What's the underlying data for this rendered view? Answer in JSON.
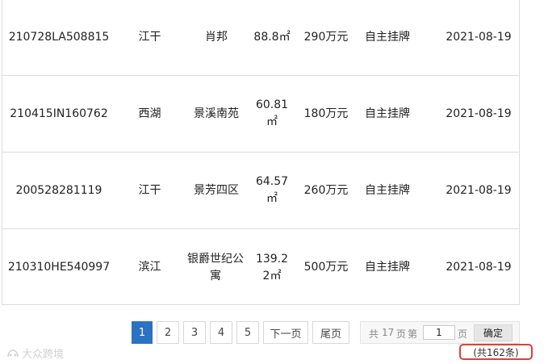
{
  "listings": [
    {
      "id": "210728LA508815",
      "district": "江干",
      "community": "肖邦",
      "area": "88.8㎡",
      "price": "290万元",
      "type": "自主挂牌",
      "date": "2021-08-19"
    },
    {
      "id": "210415IN160762",
      "district": "西湖",
      "community": "景溪南苑",
      "area": "60.81㎡",
      "price": "180万元",
      "type": "自主挂牌",
      "date": "2021-08-19"
    },
    {
      "id": "200528281119",
      "district": "江干",
      "community": "景芳四区",
      "area": "64.57㎡",
      "price": "260万元",
      "type": "自主挂牌",
      "date": "2021-08-19"
    },
    {
      "id": "210310HE540997",
      "district": "滨江",
      "community": "银爵世纪公寓",
      "area": "139.22㎡",
      "price": "500万元",
      "type": "自主挂牌",
      "date": "2021-08-19"
    }
  ],
  "pagination": {
    "pages": [
      "1",
      "2",
      "3",
      "4",
      "5"
    ],
    "current_page": "1",
    "next_label": "下一页",
    "last_label": "尾页",
    "total_prefix": "共",
    "total_pages": "17",
    "page_word": "页",
    "goto_label": "第",
    "goto_value": "1",
    "goto_suffix": "页",
    "confirm_label": "确定",
    "total_records": "(共162条)"
  },
  "watermark": {
    "text": "大众跨境"
  },
  "colors": {
    "active_page": "#2b72c3",
    "highlight_border": "#d9433b"
  }
}
